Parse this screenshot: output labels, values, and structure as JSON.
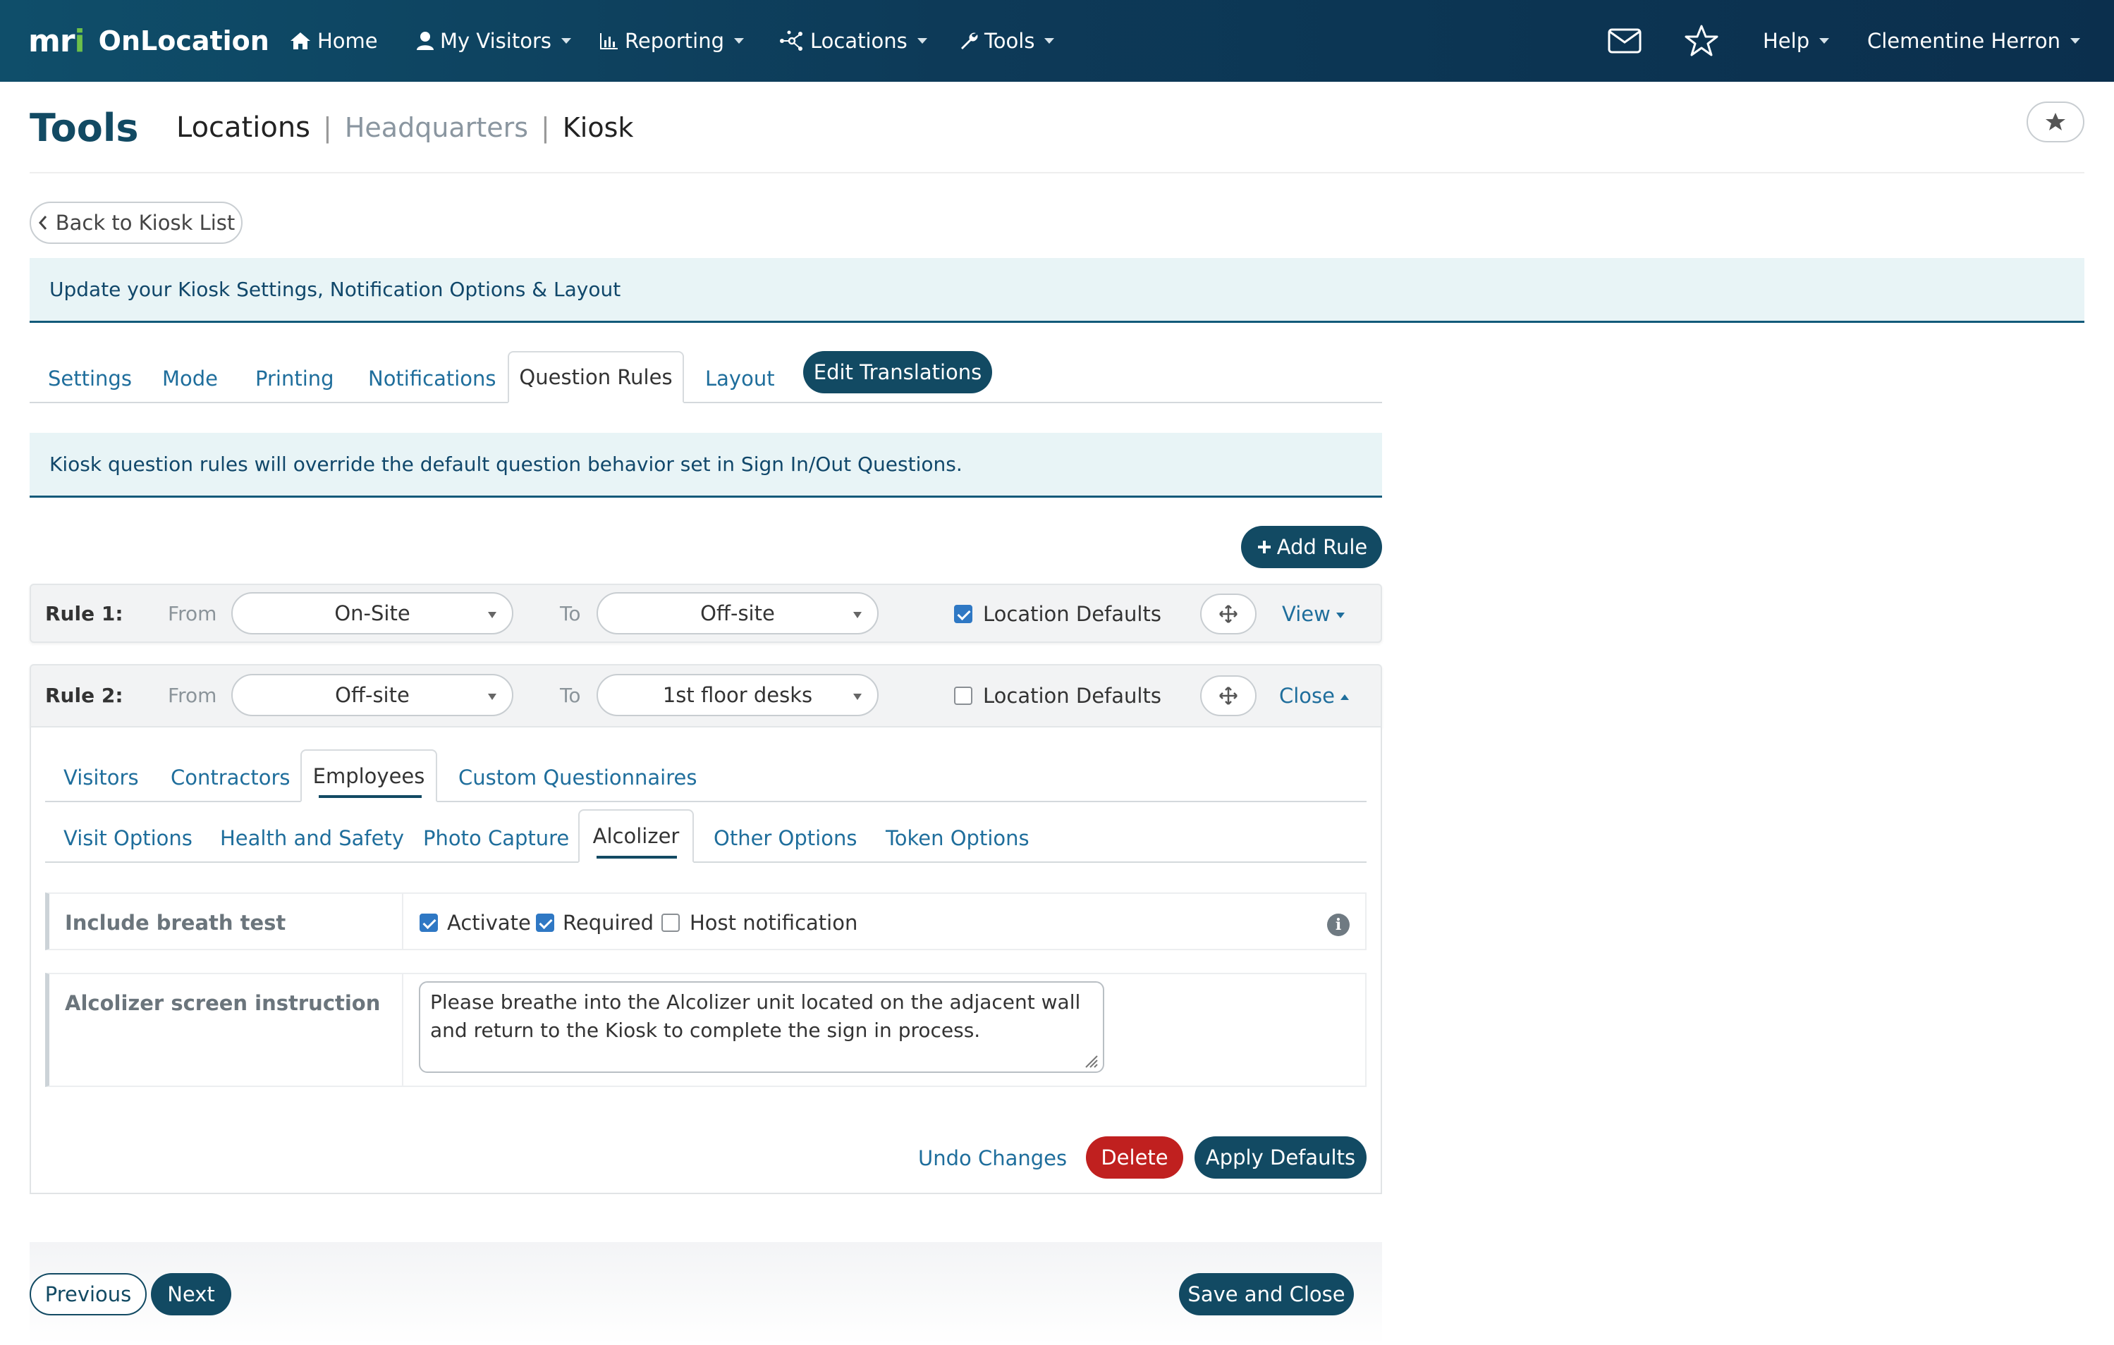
{
  "nav": {
    "logo": "mri",
    "product": "OnLocation",
    "home": "Home",
    "my_visitors": "My Visitors",
    "reporting": "Reporting",
    "locations": "Locations",
    "tools": "Tools",
    "help": "Help",
    "user": "Clementine Herron"
  },
  "header": {
    "title": "Tools",
    "crumb_locations": "Locations",
    "crumb_sep": "|",
    "crumb_headquarters": "Headquarters",
    "crumb_kiosk": "Kiosk"
  },
  "back_button": "Back to Kiosk List",
  "banner_main": "Update your Kiosk Settings, Notification Options & Layout",
  "tabs": [
    {
      "label": "Settings"
    },
    {
      "label": "Mode"
    },
    {
      "label": "Printing"
    },
    {
      "label": "Notifications"
    },
    {
      "label": "Question Rules"
    },
    {
      "label": "Layout"
    }
  ],
  "edit_translations": "Edit Translations",
  "banner_rules": "Kiosk question rules will override the default question behavior set in Sign In/Out Questions.",
  "add_rule": "Add Rule",
  "rule_from": "From",
  "rule_to": "To",
  "location_defaults": "Location Defaults",
  "rules": [
    {
      "label": "Rule 1:",
      "from": "On-Site",
      "to": "Off-site",
      "location_defaults": true,
      "toggle": "View"
    },
    {
      "label": "Rule 2:",
      "from": "Off-site",
      "to": "1st floor desks",
      "location_defaults": false,
      "toggle": "Close"
    }
  ],
  "people_tabs": [
    "Visitors",
    "Contractors",
    "Employees",
    "Custom Questionnaires"
  ],
  "option_tabs": [
    "Visit Options",
    "Health and Safety",
    "Photo Capture",
    "Alcolizer",
    "Other Options",
    "Token Options"
  ],
  "questions": {
    "breath_label": "Include breath test",
    "activate": "Activate",
    "required": "Required",
    "host_notification": "Host notification",
    "instruction_label": "Alcolizer screen instruction",
    "instruction_value": "Please breathe into the Alcolizer unit located on the adjacent wall and return to the Kiosk to complete the sign in process."
  },
  "rule_actions": {
    "undo": "Undo Changes",
    "delete": "Delete",
    "apply_defaults": "Apply Defaults"
  },
  "footer": {
    "previous": "Previous",
    "next": "Next",
    "save_close": "Save and Close"
  },
  "colors": {
    "brand_dark": "#124a63",
    "link": "#1f6e9c",
    "danger": "#c0201f",
    "checkbox": "#2f78c4",
    "logo_accent": "#6cc04a"
  }
}
